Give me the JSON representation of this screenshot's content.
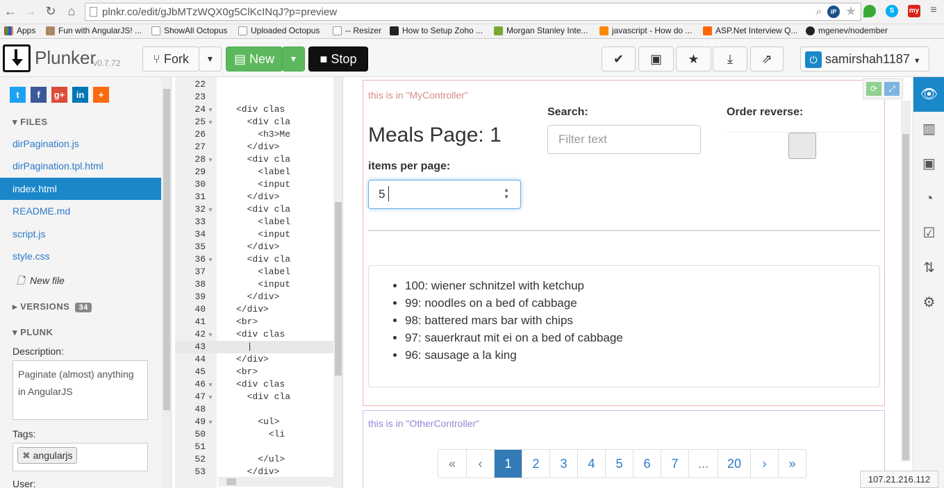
{
  "browser": {
    "url": "plnkr.co/edit/gJbMTzWQX0g5ClKcINqJ?p=preview",
    "ip_badge": "iP",
    "ext_my": "my",
    "bookmarks": [
      "Apps",
      "Fun with AngularJS! ...",
      "ShowAll Octopus",
      "Uploaded Octopus",
      "-- Resizer",
      "How to Setup Zoho ...",
      "Morgan Stanley Inte...",
      "javascript - How do ...",
      "ASP.Net Interview Q...",
      "mgenev/nodember"
    ]
  },
  "toolbar": {
    "logo": "Plunker",
    "version": "v0.7.72",
    "fork": "Fork",
    "new": "New",
    "stop": "Stop",
    "user": "samirshah1187"
  },
  "sidebar": {
    "files_head": "FILES",
    "files": [
      "dirPagination.js",
      "dirPagination.tpl.html",
      "index.html",
      "README.md",
      "script.js",
      "style.css"
    ],
    "new_file": "New file",
    "versions_head": "VERSIONS",
    "versions_count": "34",
    "plunk_head": "PLUNK",
    "description_label": "Description:",
    "description": "Paginate (almost) anything in AngularJS",
    "tags_label": "Tags:",
    "tag": "angularjs",
    "user_label": "User:"
  },
  "editor": {
    "lines": [
      {
        "n": "22",
        "code": ""
      },
      {
        "n": "23",
        "code": ""
      },
      {
        "n": "24",
        "code": "<div clas"
      },
      {
        "n": "25",
        "code": "  <div cla"
      },
      {
        "n": "26",
        "code": "    <h3>Me"
      },
      {
        "n": "27",
        "code": "  </div>"
      },
      {
        "n": "28",
        "code": "  <div cla"
      },
      {
        "n": "29",
        "code": "    <label"
      },
      {
        "n": "30",
        "code": "    <input"
      },
      {
        "n": "31",
        "code": "  </div>"
      },
      {
        "n": "32",
        "code": "  <div cla"
      },
      {
        "n": "33",
        "code": "    <label"
      },
      {
        "n": "34",
        "code": "    <input"
      },
      {
        "n": "35",
        "code": "  </div>"
      },
      {
        "n": "36",
        "code": "  <div cla"
      },
      {
        "n": "37",
        "code": "    <label"
      },
      {
        "n": "38",
        "code": "    <input"
      },
      {
        "n": "39",
        "code": "  </div>"
      },
      {
        "n": "40",
        "code": "</div>"
      },
      {
        "n": "41",
        "code": "<br>"
      },
      {
        "n": "42",
        "code": "<div clas"
      },
      {
        "n": "43",
        "code": "  |"
      },
      {
        "n": "44",
        "code": "</div>"
      },
      {
        "n": "45",
        "code": "<br>"
      },
      {
        "n": "46",
        "code": "<div clas"
      },
      {
        "n": "47",
        "code": "  <div cla"
      },
      {
        "n": "48",
        "code": ""
      },
      {
        "n": "49",
        "code": "    <ul>"
      },
      {
        "n": "50",
        "code": "      <li"
      },
      {
        "n": "51",
        "code": ""
      },
      {
        "n": "52",
        "code": "    </ul>"
      },
      {
        "n": "53",
        "code": "  </div>"
      }
    ]
  },
  "preview": {
    "ctrl1_label": "this is in \"MyController\"",
    "title": "Meals Page: 1",
    "items_label": "items per page:",
    "items_value": "5",
    "search_label": "Search:",
    "search_placeholder": "Filter text",
    "order_label": "Order reverse:",
    "meals": [
      "100: wiener schnitzel with ketchup",
      "99: noodles on a bed of cabbage",
      "98: battered mars bar with chips",
      "97: sauerkraut mit ei on a bed of cabbage",
      "96: sausage a la king"
    ],
    "ctrl2_label": "this is in \"OtherController\"",
    "pages": [
      "«",
      "‹",
      "1",
      "2",
      "3",
      "4",
      "5",
      "6",
      "7",
      "...",
      "20",
      "›",
      "»"
    ]
  },
  "status_ip": "107.21.216.112",
  "colors": {
    "accent": "#1a87c9",
    "green": "#5cb85c",
    "ctrl1": "#e07c7c",
    "ctrl2": "#7c7ce0"
  }
}
